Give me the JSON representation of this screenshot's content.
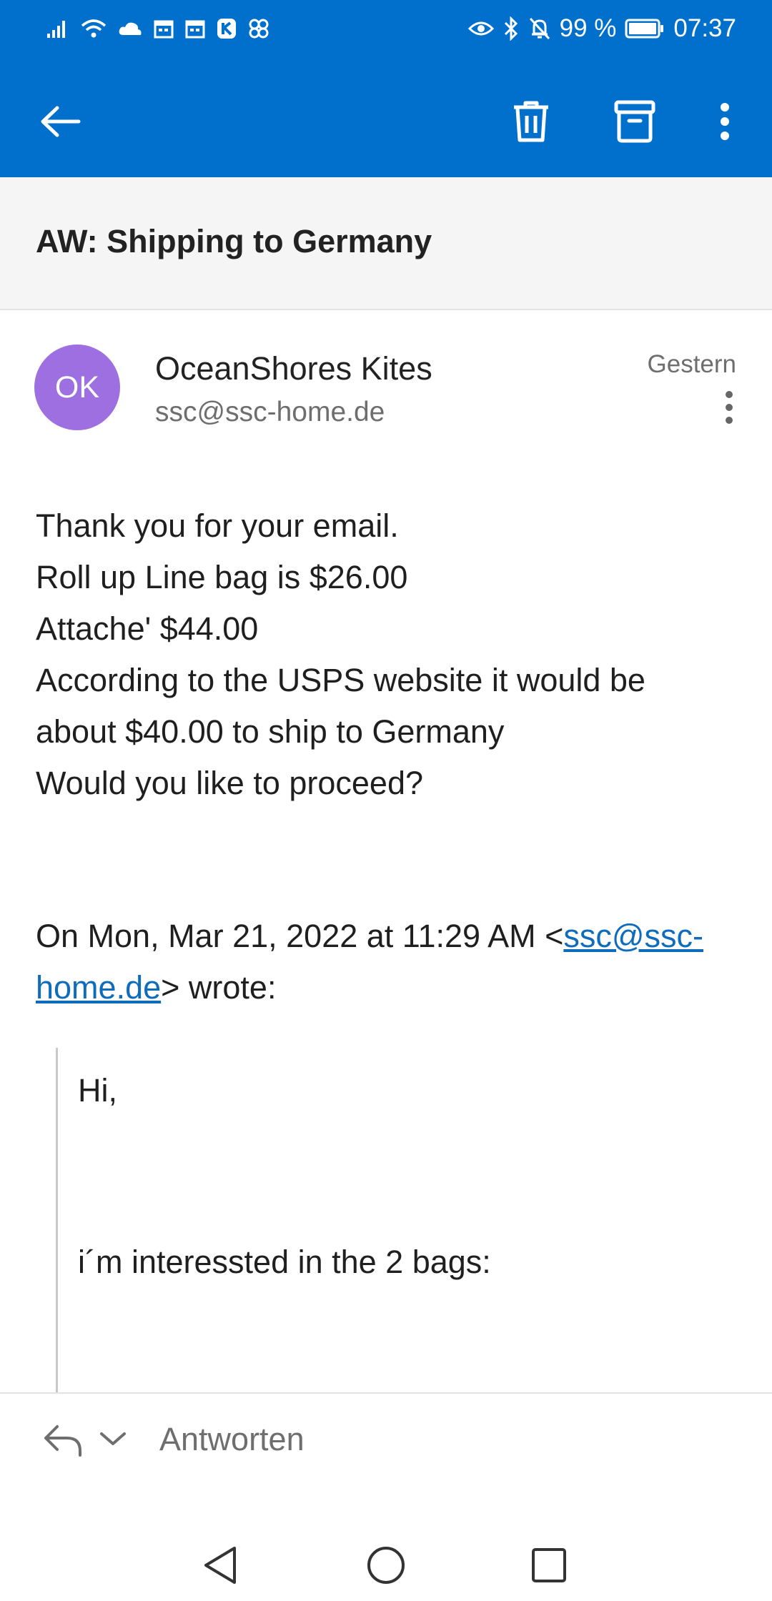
{
  "status_bar": {
    "icons": [
      "signal-icon",
      "wifi-icon",
      "cloud-icon",
      "calendar-icon",
      "calendar-icon",
      "k-app-icon",
      "pinwheel-icon",
      "eye-icon",
      "bluetooth-icon",
      "bell-off-icon",
      "battery-icon"
    ],
    "battery": "99 %",
    "time": "07:37"
  },
  "app_bar": {
    "icons": [
      "back-arrow-icon",
      "trash-icon",
      "archive-icon",
      "more-vertical-icon"
    ]
  },
  "subject": "AW: Shipping to Germany",
  "message": {
    "avatar_initials": "OK",
    "avatar_color": "#9d6fe0",
    "sender_name": "OceanShores Kites",
    "sender_email": "ssc@ssc-home.de",
    "date": "Gestern",
    "body_lines": [
      "Thank you for your email.",
      "Roll up Line bag is $26.00",
      "Attache' $44.00",
      "According to the USPS website it would be",
      "about $40.00 to ship to Germany",
      "Would you like to proceed?"
    ],
    "quote_prefix": "On Mon, Mar 21, 2022 at 11:29 AM <",
    "quote_link": "ssc@ssc-home.de",
    "quote_suffix": "> wrote:",
    "quoted_lines": [
      "Hi,",
      "i´m interessted in the 2 bags:"
    ]
  },
  "reply_bar": {
    "label": "Antworten"
  },
  "colors": {
    "accent": "#0070cc",
    "link": "#0f6cbd"
  }
}
